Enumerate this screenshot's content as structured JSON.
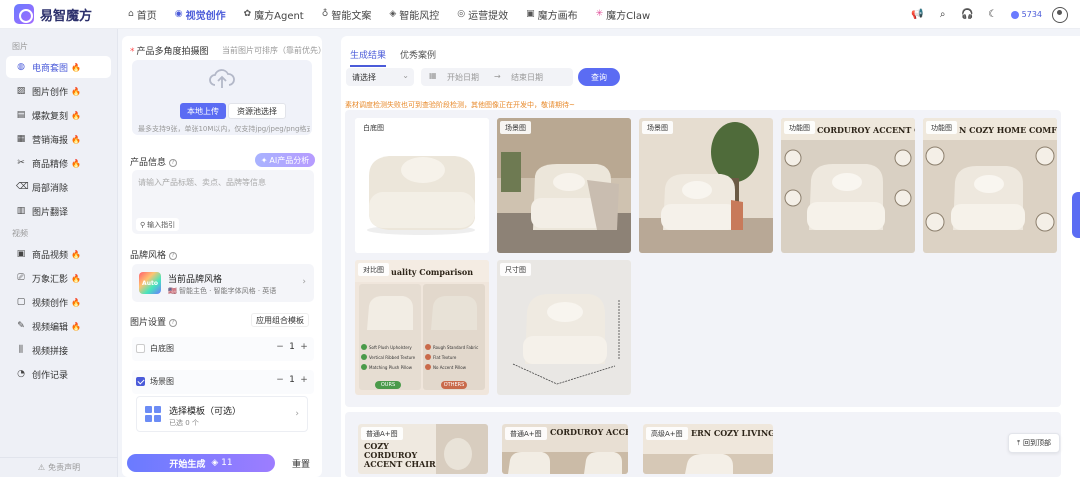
{
  "header": {
    "logo_text": "易智魔方",
    "nav": [
      {
        "label": "首页",
        "icon": "home-icon"
      },
      {
        "label": "视觉创作",
        "icon": "eye-icon",
        "active": true
      },
      {
        "label": "魔方Agent",
        "icon": "agent-icon"
      },
      {
        "label": "智能文案",
        "icon": "bulb-icon"
      },
      {
        "label": "智能风控",
        "icon": "shield-icon"
      },
      {
        "label": "运营提效",
        "icon": "gauge-icon"
      },
      {
        "label": "魔方画布",
        "icon": "canvas-icon"
      },
      {
        "label": "魔方Claw",
        "icon": "claw-icon"
      }
    ],
    "credits": "5734"
  },
  "sidebar": {
    "section_image": "图片",
    "section_video": "视频",
    "image_items": [
      {
        "label": "电商套图",
        "icon": "ecommerce-icon",
        "hot": true,
        "active": true
      },
      {
        "label": "图片创作",
        "icon": "image-create-icon",
        "hot": true
      },
      {
        "label": "爆款复刻",
        "icon": "copy-icon",
        "hot": true
      },
      {
        "label": "营销海报",
        "icon": "poster-icon",
        "hot": true
      },
      {
        "label": "商品精修",
        "icon": "retouch-icon",
        "hot": true
      },
      {
        "label": "局部消除",
        "icon": "erase-icon",
        "hot": false
      },
      {
        "label": "图片翻译",
        "icon": "translate-icon",
        "hot": false
      }
    ],
    "video_items": [
      {
        "label": "商品视频",
        "icon": "product-video-icon",
        "hot": true
      },
      {
        "label": "万象汇影",
        "icon": "film-icon",
        "hot": true
      },
      {
        "label": "视频创作",
        "icon": "video-create-icon",
        "hot": true
      },
      {
        "label": "视频编辑",
        "icon": "video-edit-icon",
        "hot": true
      },
      {
        "label": "视频拼接",
        "icon": "splice-icon",
        "hot": false
      },
      {
        "label": "创作记录",
        "icon": "history-icon",
        "hot": false
      }
    ],
    "footer": "免责声明"
  },
  "form": {
    "upload_label": "产品多角度拍摄图",
    "upload_hint_right": "当前图片可排序（靠前优先）",
    "btn_local": "本地上传",
    "btn_library": "资源池选择",
    "upload_hint": "最多支持9张，单张10M以内，仅支持jpg/jpeg/png格式",
    "product_info_label": "产品信息",
    "ai_analyze": "AI产品分析",
    "product_info_placeholder": "请输入产品标题、卖点、品牌等信息",
    "example_btn": "输入指引",
    "brand_label": "品牌风格",
    "brand_logo_text": "Auto",
    "brand_name": "当前品牌风格",
    "brand_sub": "🇺🇸 智能主色 · 智能字体风格 · 英语",
    "image_settings_label": "图片设置",
    "combo_btn": "应用组合模板",
    "rows": [
      {
        "label": "白底图",
        "checked": false,
        "qty": "1"
      },
      {
        "label": "场景图",
        "checked": true,
        "qty": "1"
      }
    ],
    "template_name": "选择模板（可选）",
    "template_sub": "已选 0 个",
    "generate": "开始生成",
    "generate_cost": "11",
    "reset": "重置"
  },
  "results": {
    "tabs": [
      "生成结果",
      "优秀案例"
    ],
    "select_placeholder": "请选择",
    "date_start": "开始日期",
    "date_sep": "→",
    "date_end": "结束日期",
    "query": "查询",
    "notice": "素材调度检测失败也可到查验阶段检测，其他图像正在开发中，敬请期待~",
    "cards": [
      {
        "tag": "白底图"
      },
      {
        "tag": "场景图"
      },
      {
        "tag": "场景图"
      },
      {
        "tag": "功能图",
        "title": "CORDUROY ACCENT CHAIR"
      },
      {
        "tag": "功能图",
        "title": "N COZY HOME COMFORT"
      },
      {
        "tag": "对比图",
        "title": "uality Comparison",
        "pros": [
          "Soft Plush Upholstery",
          "Vertical Ribbed Texture",
          "Matching Plush Pillow"
        ],
        "cons": [
          "Rough Standard Fabric",
          "Flat Texture",
          "No Accent Pillow"
        ],
        "ours": "OURS",
        "others": "OTHERS"
      },
      {
        "tag": "尺寸图"
      }
    ],
    "aplus": [
      {
        "tag": "普通A+图",
        "title": "COZY CORDUROY ACCENT CHAIR"
      },
      {
        "tag": "普通A+图",
        "title": "CORDUROY ACCENT CHAIR"
      },
      {
        "tag": "高级A+图",
        "title": "ERN COZY LIVING"
      }
    ],
    "back_top": "回到顶部"
  }
}
